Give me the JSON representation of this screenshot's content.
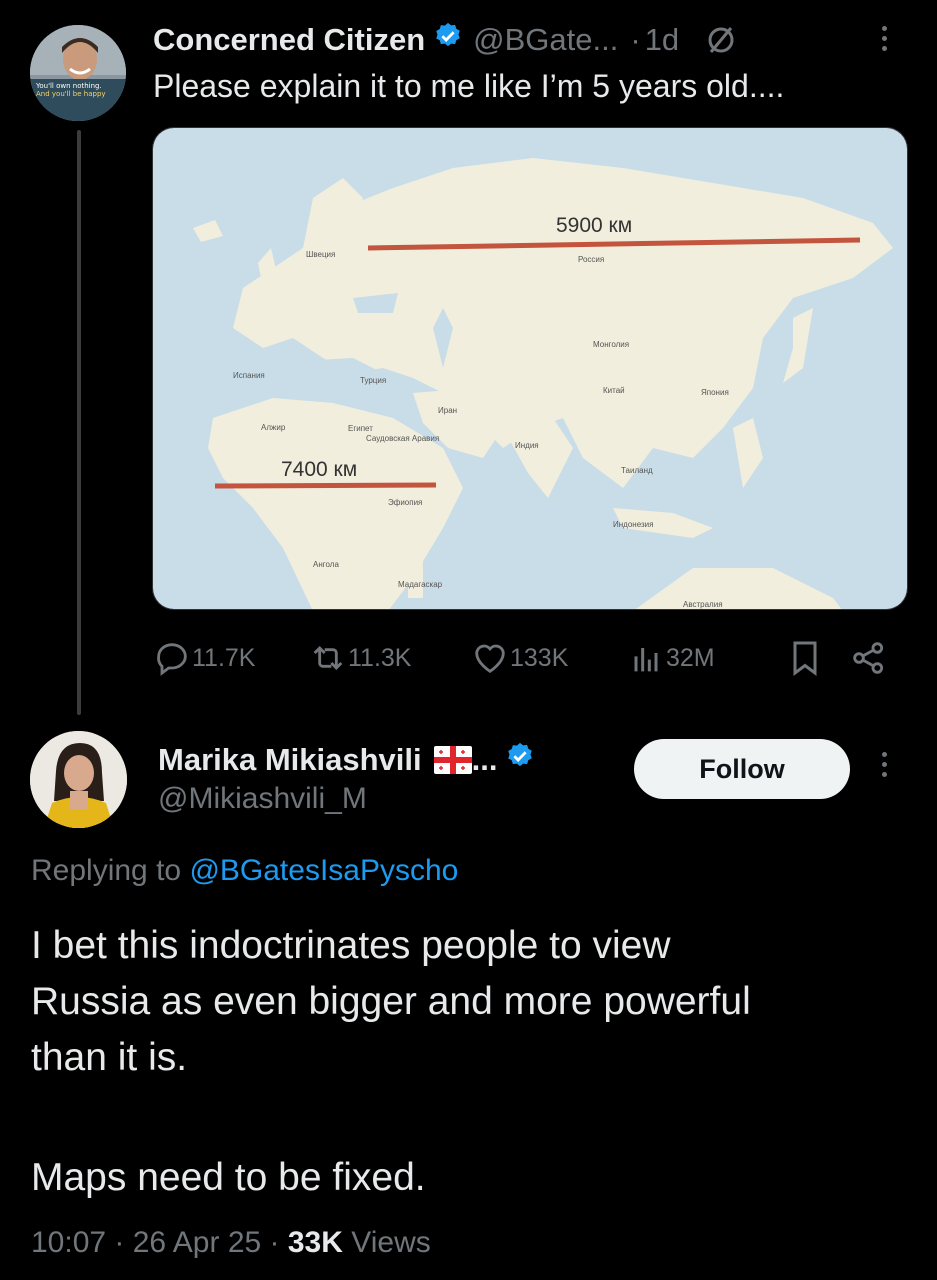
{
  "tweet": {
    "author_name": "Concerned Citizen",
    "handle": "@BGate...",
    "separator": "·",
    "time": "1d",
    "text": "Please explain it to me like I’m 5 years old....",
    "avatar_caption_line1": "You'll own nothing.",
    "avatar_caption_line2": "And you'll be happy",
    "image": {
      "label_top": "5900 км",
      "label_bottom": "7400 км",
      "place_labels": [
        "Швеция",
        "Россия",
        "Монголия",
        "Китай",
        "Япония",
        "Испания",
        "Турция",
        "Иран",
        "Алжир",
        "Египет",
        "Саудовская Аравия",
        "Индия",
        "Таиланд",
        "Индонезия",
        "Эфиопия",
        "Ангола",
        "Мадагаскар",
        "Австралия"
      ],
      "colors": {
        "water": "#c9dde9",
        "land": "#f1eedd",
        "line": "#c3543e"
      }
    },
    "stats": {
      "replies": "11.7K",
      "reposts": "11.3K",
      "likes": "133K",
      "views": "32M"
    }
  },
  "reply": {
    "author_name": "Marika Mikiashvili",
    "flag_emoji": "🇬🇪",
    "ellipsis": "...",
    "handle": "@Mikiashvili_M",
    "follow_label": "Follow",
    "replying_prefix": "Replying to",
    "replying_handle": "@BGatesIsaPyscho",
    "text_line1": "I bet this indoctrinates people to view",
    "text_line2": "Russia as even bigger and more powerful",
    "text_line3": "than it is.",
    "text_line4": "Maps need to be fixed.",
    "time": "10:07",
    "date": "26 Apr 25",
    "views_count": "33K",
    "views_label": "Views"
  },
  "theme": {
    "verified": "#1d9bf0",
    "link": "#1d9bf0",
    "muted": "#71767b"
  }
}
